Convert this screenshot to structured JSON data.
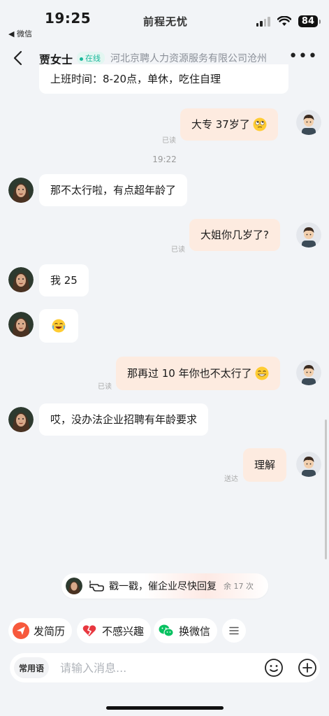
{
  "status_bar": {
    "time": "19:25",
    "back_app": "◀ 微信",
    "app_brand": "前程无忧",
    "battery": "84"
  },
  "nav": {
    "contact_name": "贾女士",
    "online_label": "在线",
    "company": "河北京聘人力资源服务有限公司沧州"
  },
  "messages": {
    "partial_in": "上班时间：8-20点，单休，吃住自理",
    "m1_text": "大专  37岁了",
    "m1_status": "已读",
    "time_sep": "19:22",
    "m2_text": "那不太行啦，有点超年龄了",
    "m3_text": "大姐你几岁了?",
    "m3_status": "已读",
    "m4_text": "我 25",
    "m5_emoji": "😂",
    "m6_text": "那再过 10 年你也不太行了",
    "m6_status": "已读",
    "m7_text": "哎，没办法企业招聘有年龄要求",
    "m8_text": "理解",
    "m8_status": "送达"
  },
  "poke": {
    "label": "戳一戳，催企业尽快回复",
    "remaining": "余 17 次"
  },
  "quick_actions": {
    "send_resume": "发简历",
    "not_interested": "不感兴趣",
    "exchange_wechat": "换微信"
  },
  "input": {
    "common_phrases": "常用语",
    "placeholder": "请输入消息..."
  },
  "colors": {
    "accent_orange": "#f7593c",
    "online_green": "#19b89a",
    "wechat_green": "#07c160",
    "out_bubble": "#fdebe0"
  }
}
